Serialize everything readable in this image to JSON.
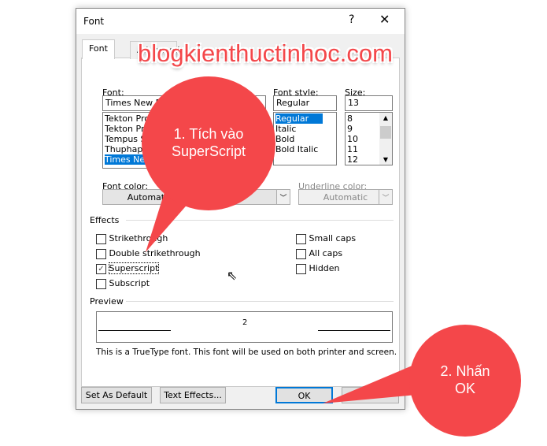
{
  "dialog": {
    "title": "Font",
    "help": "?",
    "close": "✕"
  },
  "tabs": [
    {
      "label": "Font",
      "active": true
    },
    {
      "label": "Advanced",
      "active": false
    }
  ],
  "font": {
    "label": "Font:",
    "value": "Times New Roman",
    "items": [
      "Tekton Pro Cond",
      "Tekton Pro Ext",
      "Tempus Sans ITC",
      "ThuphapX",
      "Times New Roman"
    ],
    "selected": "Times New Roman"
  },
  "style": {
    "label": "Font style:",
    "value": "Regular",
    "items": [
      "Regular",
      "Italic",
      "Bold",
      "Bold Italic"
    ],
    "selected": "Regular"
  },
  "size": {
    "label": "Size:",
    "value": "13",
    "items": [
      "8",
      "9",
      "10",
      "11",
      "12"
    ]
  },
  "font_color": {
    "label": "Font color:",
    "value": "Automatic"
  },
  "underline_color": {
    "label": "Underline color:",
    "value": "Automatic"
  },
  "effects": {
    "label": "Effects",
    "left": [
      {
        "label": "Strikethrough",
        "checked": false
      },
      {
        "label": "Double strikethrough",
        "checked": false
      },
      {
        "label": "Superscript",
        "checked": true
      },
      {
        "label": "Subscript",
        "checked": false
      }
    ],
    "right": [
      {
        "label": "Small caps",
        "checked": false
      },
      {
        "label": "All caps",
        "checked": false
      },
      {
        "label": "Hidden",
        "checked": false
      }
    ]
  },
  "preview": {
    "label": "Preview",
    "text": "2",
    "note": "This is a TrueType font. This font will be used on both printer and screen."
  },
  "buttons": {
    "set_default": "Set As Default",
    "text_effects": "Text Effects...",
    "ok": "OK"
  },
  "annotations": {
    "watermark": "blogkienthuctinhoc.com",
    "callout1": "1. Tích vào SuperScript",
    "callout2": "2. Nhấn OK",
    "color": "#f4474a"
  }
}
